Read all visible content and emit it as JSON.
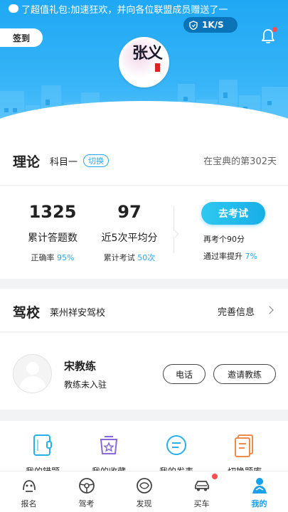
{
  "status_bar": {
    "notification_text": "了超值礼包:加速狂欢，并向各位联盟成员赠送了一",
    "net_speed": "1K/S"
  },
  "header": {
    "signin_label": "签到",
    "username": "张义",
    "avatar_text": "张义"
  },
  "theory": {
    "title": "理论",
    "subject": "科目一",
    "switch_label": "切换",
    "days_text": "在宝典的第302天",
    "stats": [
      {
        "value": "1325",
        "label": "累计答题数",
        "sub_prefix": "正确率",
        "sub_value": "95%"
      },
      {
        "value": "97",
        "label": "近5次平均分",
        "sub_prefix": "累计考试",
        "sub_value": "50次"
      }
    ],
    "exam_button": "去考试",
    "tip_line1": "再考个90分",
    "tip_line2_prefix": "通过率提升",
    "tip_line2_value": "7%"
  },
  "school": {
    "title": "驾校",
    "name": "莱州祥安驾校",
    "complete_label": "完善信息"
  },
  "coach": {
    "name": "宋教练",
    "status": "教练未入驻",
    "phone_button": "电话",
    "invite_button": "邀请教练"
  },
  "tools": [
    {
      "icon": "wrong-book-icon",
      "label": "我的错题"
    },
    {
      "icon": "favorites-icon",
      "label": "我的收藏"
    },
    {
      "icon": "comment-icon",
      "label": "我的发表"
    },
    {
      "icon": "switch-bank-icon",
      "label": "切换题库"
    }
  ],
  "nav": {
    "items": [
      {
        "icon": "signup-icon",
        "label": "报名"
      },
      {
        "icon": "exam-icon",
        "label": "驾考"
      },
      {
        "icon": "discover-icon",
        "label": "发现"
      },
      {
        "icon": "car-icon",
        "label": "买车"
      },
      {
        "icon": "profile-icon",
        "label": "我的"
      }
    ]
  },
  "colors": {
    "accent": "#1aa0e8",
    "header": "#29aef5",
    "badge": "#ff4d4f"
  }
}
